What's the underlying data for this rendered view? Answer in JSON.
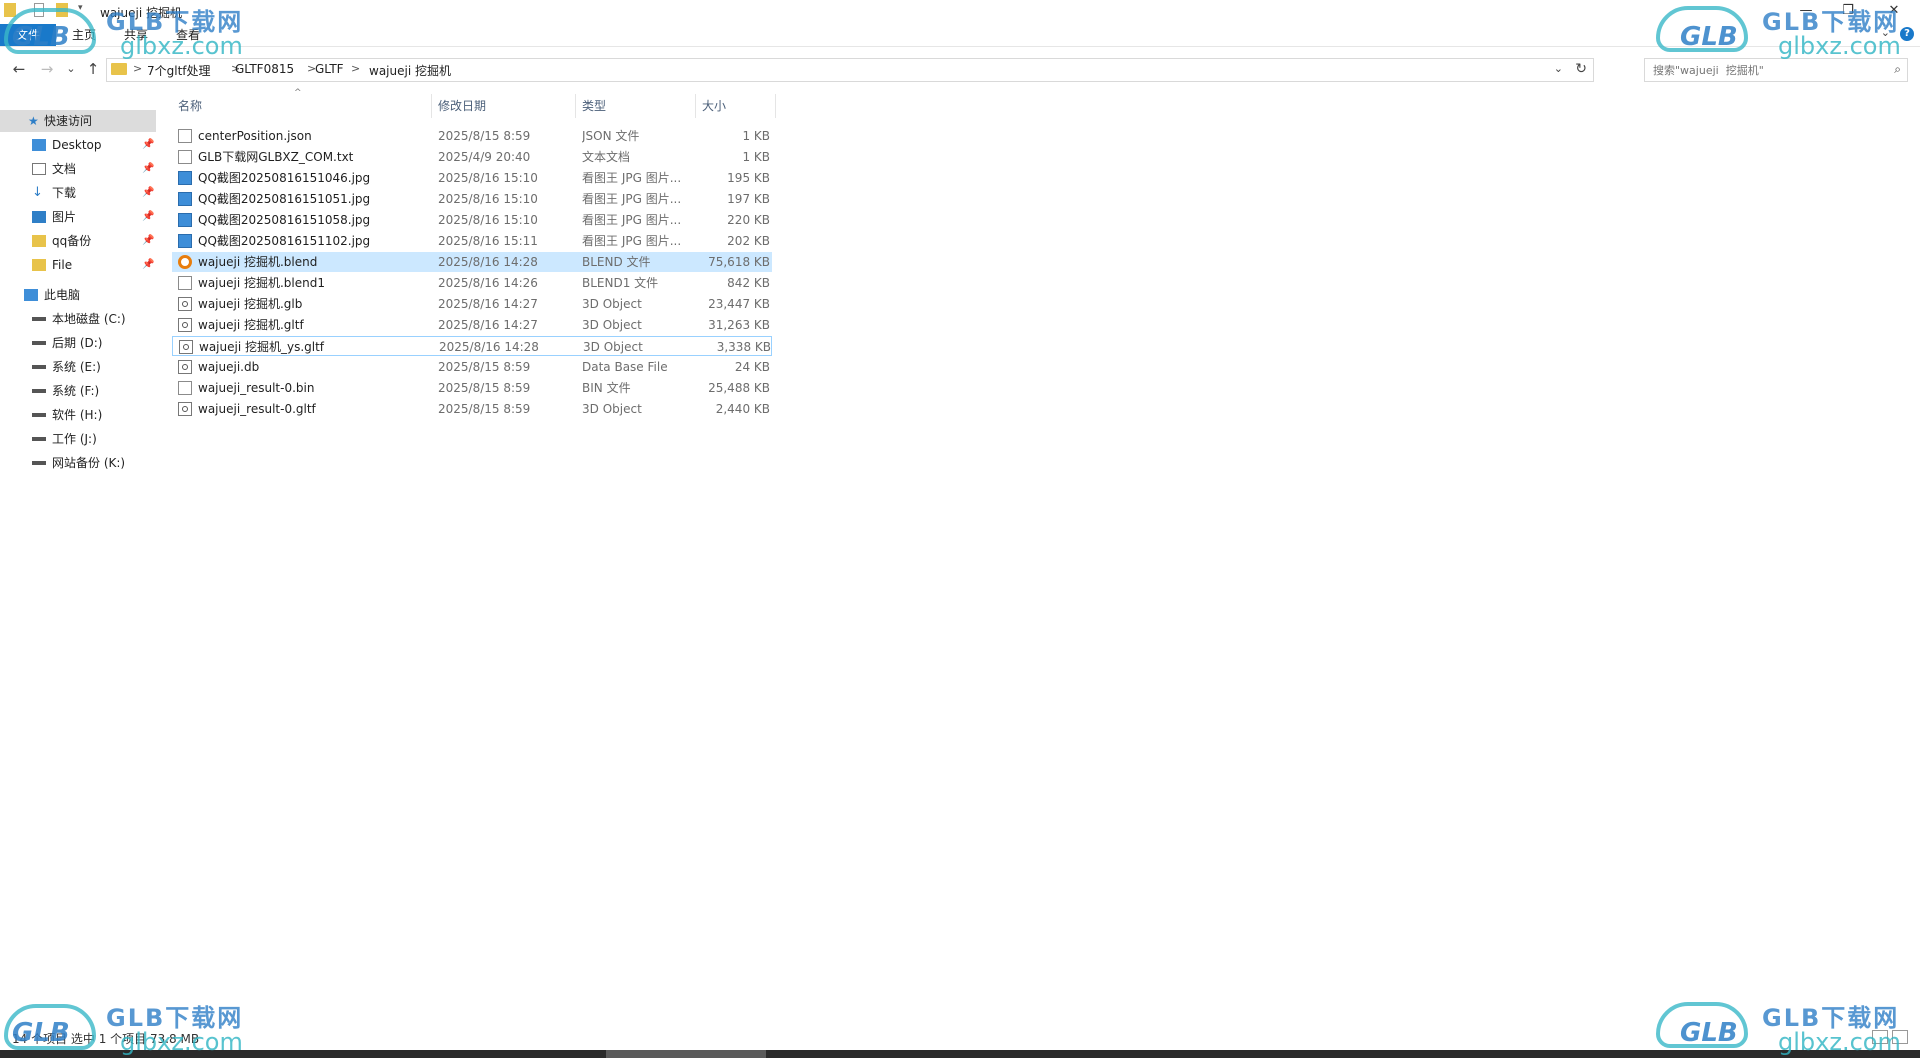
{
  "window": {
    "title": "wajueji  挖掘机",
    "controls": {
      "minimize": "—",
      "maximize": "❐",
      "close": "✕"
    }
  },
  "ribbon": {
    "tabs": [
      "文件",
      "主页",
      "共享",
      "查看"
    ],
    "help": "?",
    "expand": "⌄"
  },
  "nav": {
    "back": "←",
    "forward": "→",
    "recent": "⌄",
    "up": "↑",
    "breadcrumb": [
      "7个gltf处理",
      "GLTF0815",
      "GLTF",
      "wajueji  挖掘机"
    ],
    "separator": ">",
    "dropdown": "⌄",
    "refresh": "↻",
    "search_placeholder": "搜索\"wajueji  挖掘机\""
  },
  "sidebar": {
    "quick_access": {
      "label": "快速访问",
      "items": [
        {
          "label": "Desktop",
          "icon": "desktop-icon",
          "pinned": true
        },
        {
          "label": "文档",
          "icon": "documents-icon",
          "pinned": true
        },
        {
          "label": "下载",
          "icon": "download-icon",
          "pinned": true
        },
        {
          "label": "图片",
          "icon": "pictures-icon",
          "pinned": true
        },
        {
          "label": "qq备份",
          "icon": "folder-icon",
          "pinned": true
        },
        {
          "label": "File",
          "icon": "folder-icon",
          "pinned": true
        }
      ]
    },
    "this_pc": {
      "label": "此电脑",
      "drives": [
        "本地磁盘 (C:)",
        "后期 (D:)",
        "系统 (E:)",
        "系统 (F:)",
        "软件 (H:)",
        "工作 (J:)",
        "网站备份 (K:)"
      ]
    },
    "pin_glyph": "📌"
  },
  "columns": [
    "名称",
    "修改日期",
    "类型",
    "大小"
  ],
  "files": [
    {
      "name": "centerPosition.json",
      "date": "2025/8/15 8:59",
      "type": "JSON 文件",
      "size": "1 KB",
      "icon": "doc"
    },
    {
      "name": "GLB下载网GLBXZ_COM.txt",
      "date": "2025/4/9 20:40",
      "type": "文本文档",
      "size": "1 KB",
      "icon": "doc"
    },
    {
      "name": "QQ截图20250816151046.jpg",
      "date": "2025/8/16 15:10",
      "type": "看图王 JPG 图片...",
      "size": "195 KB",
      "icon": "img"
    },
    {
      "name": "QQ截图20250816151051.jpg",
      "date": "2025/8/16 15:10",
      "type": "看图王 JPG 图片...",
      "size": "197 KB",
      "icon": "img"
    },
    {
      "name": "QQ截图20250816151058.jpg",
      "date": "2025/8/16 15:10",
      "type": "看图王 JPG 图片...",
      "size": "220 KB",
      "icon": "img"
    },
    {
      "name": "QQ截图20250816151102.jpg",
      "date": "2025/8/16 15:11",
      "type": "看图王 JPG 图片...",
      "size": "202 KB",
      "icon": "img"
    },
    {
      "name": "wajueji  挖掘机.blend",
      "date": "2025/8/16 14:28",
      "type": "BLEND 文件",
      "size": "75,618 KB",
      "icon": "blend",
      "selected": true
    },
    {
      "name": "wajueji  挖掘机.blend1",
      "date": "2025/8/16 14:26",
      "type": "BLEND1 文件",
      "size": "842 KB",
      "icon": "doc"
    },
    {
      "name": "wajueji  挖掘机.glb",
      "date": "2025/8/16 14:27",
      "type": "3D Object",
      "size": "23,447 KB",
      "icon": "3d"
    },
    {
      "name": "wajueji  挖掘机.gltf",
      "date": "2025/8/16 14:27",
      "type": "3D Object",
      "size": "31,263 KB",
      "icon": "3d"
    },
    {
      "name": "wajueji  挖掘机_ys.gltf",
      "date": "2025/8/16 14:28",
      "type": "3D Object",
      "size": "3,338 KB",
      "icon": "3d",
      "focused": true
    },
    {
      "name": "wajueji.db",
      "date": "2025/8/15 8:59",
      "type": "Data Base File",
      "size": "24 KB",
      "icon": "3d"
    },
    {
      "name": "wajueji_result-0.bin",
      "date": "2025/8/15 8:59",
      "type": "BIN 文件",
      "size": "25,488 KB",
      "icon": "doc"
    },
    {
      "name": "wajueji_result-0.gltf",
      "date": "2025/8/15 8:59",
      "type": "3D Object",
      "size": "2,440 KB",
      "icon": "3d"
    }
  ],
  "status": "14 个项目    选中 1 个项目  73.8 MB",
  "watermark": {
    "glb": "GLB",
    "title": "GLB下载网",
    "url": "glbxz.com"
  },
  "colors": {
    "accent": "#1979ca",
    "selection": "#cce8ff",
    "selection_border": "#99d1ff"
  }
}
